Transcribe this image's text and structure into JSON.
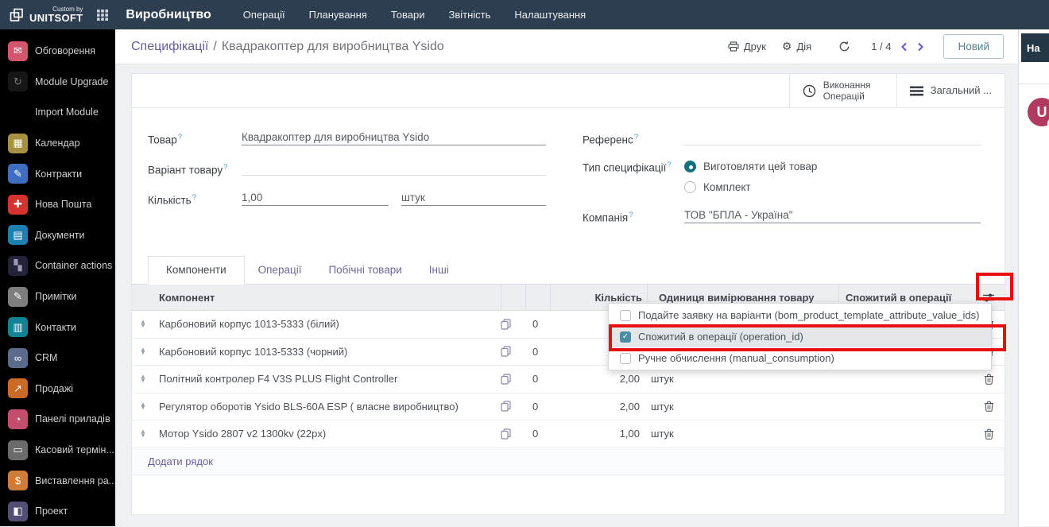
{
  "colors": {
    "navbar": "#2d3e50",
    "sidebar": "#000000",
    "link_violet": "#675d94",
    "accent_teal": "#12717c",
    "checkbox_teal": "#4a8ca3",
    "annotation_red": "#e8100f",
    "avatar": "#b23a5f"
  },
  "navbar": {
    "logo": {
      "line1": "Custom by",
      "line2": "UNITSOFT"
    },
    "app_name": "Виробництво",
    "menus": [
      {
        "label": "Операції"
      },
      {
        "label": "Планування"
      },
      {
        "label": "Товари"
      },
      {
        "label": "Звітність"
      },
      {
        "label": "Налаштування"
      }
    ]
  },
  "sidebar": {
    "items": [
      {
        "label": "Обговорення",
        "icon": "chat-icon",
        "glyph": "✉",
        "color": "#d4566e",
        "fg": "#ffffff"
      },
      {
        "label": "Module Upgrade",
        "icon": "module-upgrade-icon",
        "glyph": "↻",
        "color": "#161616",
        "fg": "#7a7a7a"
      },
      {
        "label": "Import Module",
        "icon": "import-module-icon",
        "glyph": "",
        "color": "transparent",
        "fg": "#ffffff"
      },
      {
        "label": "Календар",
        "icon": "calendar-icon",
        "glyph": "▦",
        "color": "#a59141",
        "fg": "#ffffff"
      },
      {
        "label": "Контракти",
        "icon": "contracts-icon",
        "glyph": "✎",
        "color": "#3f6dbf",
        "fg": "#ffffff"
      },
      {
        "label": "Нова Пошта",
        "icon": "nova-poshta-icon",
        "glyph": "✚",
        "color": "#d6322e",
        "fg": "#ffffff"
      },
      {
        "label": "Документи",
        "icon": "documents-icon",
        "glyph": "▤",
        "color": "#1f7fae",
        "fg": "#ffffff"
      },
      {
        "label": "Container actions",
        "icon": "container-actions-icon",
        "glyph": "▚",
        "color": "#23233a",
        "fg": "#9b9bb5"
      },
      {
        "label": "Примітки",
        "icon": "notes-icon",
        "glyph": "✎",
        "color": "#7d7d7d",
        "fg": "#ffffff"
      },
      {
        "label": "Контакти",
        "icon": "contacts-icon",
        "glyph": "▥",
        "color": "#128394",
        "fg": "#ffffff"
      },
      {
        "label": "CRM",
        "icon": "crm-icon",
        "glyph": "∞",
        "color": "#5a6b8c",
        "fg": "#ffffff"
      },
      {
        "label": "Продажі",
        "icon": "sales-icon",
        "glyph": "↗",
        "color": "#c96a28",
        "fg": "#ffffff"
      },
      {
        "label": "Панелі приладів",
        "icon": "dashboard-icon",
        "glyph": "◔",
        "color": "#c24d6c",
        "fg": "#ffffff"
      },
      {
        "label": "Касовий термін...",
        "icon": "pos-icon",
        "glyph": "▭",
        "color": "#6b6b6b",
        "fg": "#ffffff"
      },
      {
        "label": "Виставлення ра...",
        "icon": "invoicing-icon",
        "glyph": "$",
        "color": "#cf7c3a",
        "fg": "#ffffff"
      },
      {
        "label": "Проект",
        "icon": "project-icon",
        "glyph": "◧",
        "color": "#514f75",
        "fg": "#ffffff"
      }
    ]
  },
  "control_panel": {
    "breadcrumb": {
      "parent": "Специфікації",
      "separator": "/",
      "current": "Квадракоптер для виробництва Ysido"
    },
    "print_label": "Друк",
    "action_label": "Дія",
    "pager_value": "1 / 4",
    "new_button": "Новий"
  },
  "right_panel": {
    "button_label": "На",
    "avatar_letter": "U"
  },
  "form": {
    "help_marker": "?",
    "stat_buttons": [
      {
        "line1": "Виконання",
        "line2": "Операцій"
      },
      {
        "line1": "Загальний ...",
        "line2": ""
      }
    ],
    "fields": {
      "product": {
        "label": "Товар",
        "value": "Квадракоптер для виробництва Ysido"
      },
      "variant": {
        "label": "Варіант товару",
        "value": ""
      },
      "quantity": {
        "label": "Кількість",
        "value": "1,00",
        "uom": "штук"
      },
      "reference": {
        "label": "Референс",
        "value": ""
      },
      "bom_type": {
        "label": "Тип специфікації",
        "options": [
          {
            "label": "Виготовляти цей товар",
            "selected": true
          },
          {
            "label": "Комплект",
            "selected": false
          }
        ]
      },
      "company": {
        "label": "Компанія",
        "value": "ТОВ \"БПЛА - Україна\""
      }
    },
    "tabs": [
      {
        "label": "Компоненти",
        "active": true
      },
      {
        "label": "Операції",
        "active": false
      },
      {
        "label": "Побічні товари",
        "active": false
      },
      {
        "label": "Інші",
        "active": false
      }
    ],
    "table": {
      "headers": {
        "component": "Компонент",
        "quantity": "Кількість",
        "uom": "Одиниця вимірювання товару",
        "operation": "Спожитий в операції"
      },
      "rows": [
        {
          "name": "Карбоновий корпус 1013-5333 (білий)",
          "count": "0",
          "qty": "",
          "uom": "",
          "operation": ""
        },
        {
          "name": "Карбоновий корпус 1013-5333 (чорний)",
          "count": "0",
          "qty": "",
          "uom": "",
          "operation": ""
        },
        {
          "name": "Політний контролер F4 V3S PLUS Flight Controller",
          "count": "0",
          "qty": "2,00",
          "uom": "штук",
          "operation": ""
        },
        {
          "name": "Регулятор оборотів Ysido BLS-60A ESP ( власне виробництво)",
          "count": "0",
          "qty": "2,00",
          "uom": "штук",
          "operation": ""
        },
        {
          "name": "Мотор Ysido 2807 v2 1300kv (22px)",
          "count": "0",
          "qty": "1,00",
          "uom": "штук",
          "operation": ""
        }
      ],
      "add_row_label": "Додати рядок"
    }
  },
  "dropdown": {
    "items": [
      {
        "label": "Подайте заявку на варіанти (bom_product_template_attribute_value_ids)",
        "checked": false,
        "highlighted": false
      },
      {
        "label": "Спожитий в операції (operation_id)",
        "checked": true,
        "highlighted": true
      },
      {
        "label": "Ручне обчислення (manual_consumption)",
        "checked": false,
        "highlighted": false
      }
    ]
  }
}
